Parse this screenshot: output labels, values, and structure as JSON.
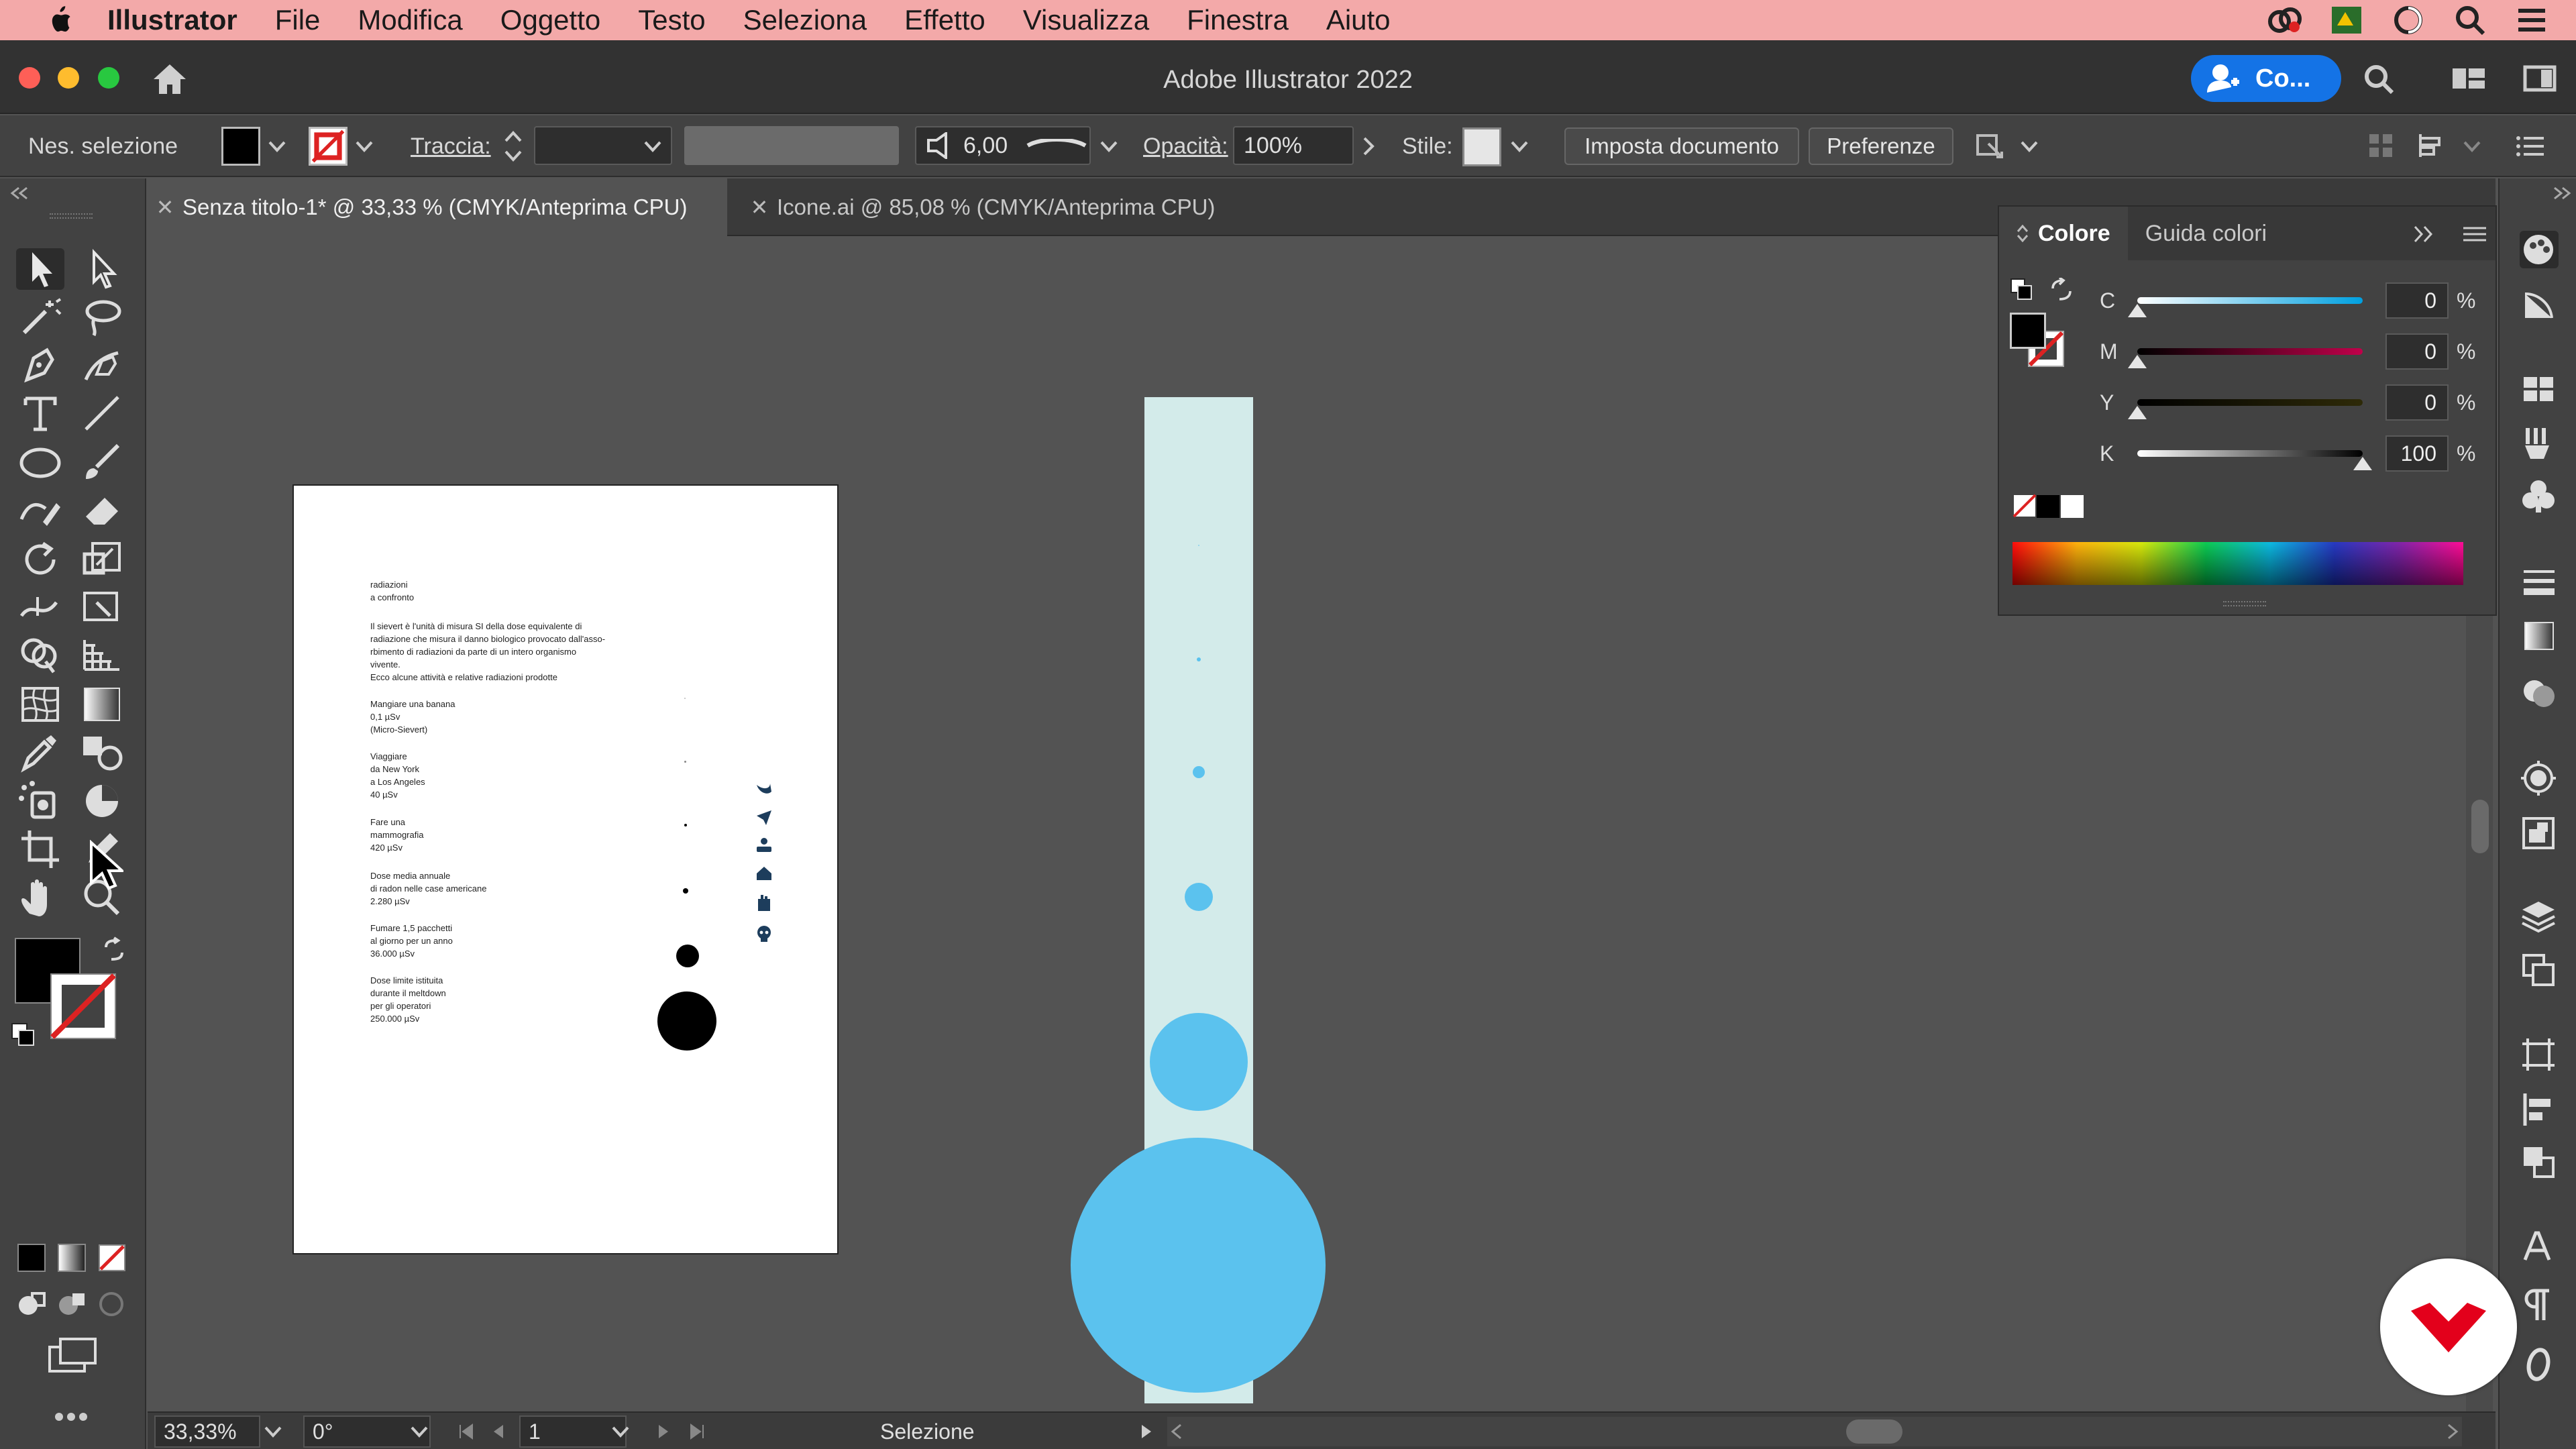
{
  "menubar": {
    "app_name": "Illustrator",
    "items": [
      "File",
      "Modifica",
      "Oggetto",
      "Testo",
      "Seleziona",
      "Effetto",
      "Visualizza",
      "Finestra",
      "Aiuto"
    ]
  },
  "titlebar": {
    "title": "Adobe Illustrator 2022",
    "share_label": "Co..."
  },
  "controlbar": {
    "selection_label": "Nes. selezione",
    "stroke_label": "Traccia:",
    "brush_size": "6,00",
    "opacity_label": "Opacità:",
    "opacity_value": "100%",
    "style_label": "Stile:",
    "document_setup": "Imposta documento",
    "preferences": "Preferenze"
  },
  "tabs": [
    {
      "label": "Senza titolo-1* @ 33,33 % (CMYK/Anteprima CPU)",
      "active": true
    },
    {
      "label": "Icone.ai @ 85,08 % (CMYK/Anteprima CPU)",
      "active": false
    }
  ],
  "artboard": {
    "title": "radiazioni\na confronto",
    "intro": "Il sievert è l'unità di misura SI della dose equivalente di\nradiazione che misura il danno biologico provocato dall'asso-\nrbimento di radiazioni da parte di un intero organismo\nvivente.\nEcco alcune attività e relative radiazioni prodotte",
    "items": [
      "Mangiare una banana\n0,1 µSv\n(Micro-Sievert)",
      "Viaggiare\nda New York\na Los Angeles\n40 µSv",
      "Fare una\nmammografia\n420 µSv",
      "Dose media annuale\ndi radon nelle case americane\n2.280 µSv",
      "Fumare 1,5 pacchetti\nal giorno per un anno\n36.000 µSv",
      "Dose limite istituita\ndurante il meltdown\nper gli operatori\n250.000 µSv"
    ]
  },
  "color_panel": {
    "tabs": [
      "Colore",
      "Guida colori"
    ],
    "channels": [
      {
        "label": "C",
        "value": "0"
      },
      {
        "label": "M",
        "value": "0"
      },
      {
        "label": "Y",
        "value": "0"
      },
      {
        "label": "K",
        "value": "100"
      }
    ],
    "unit": "%"
  },
  "statusbar": {
    "zoom": "33,33%",
    "rotation": "0°",
    "artboard_number": "1",
    "tool_name": "Selezione"
  },
  "colors": {
    "accent": "#1473e6",
    "menubar": "#f3a9a9",
    "thermo": "#d3ebea",
    "dots": "#5bc2ee"
  }
}
